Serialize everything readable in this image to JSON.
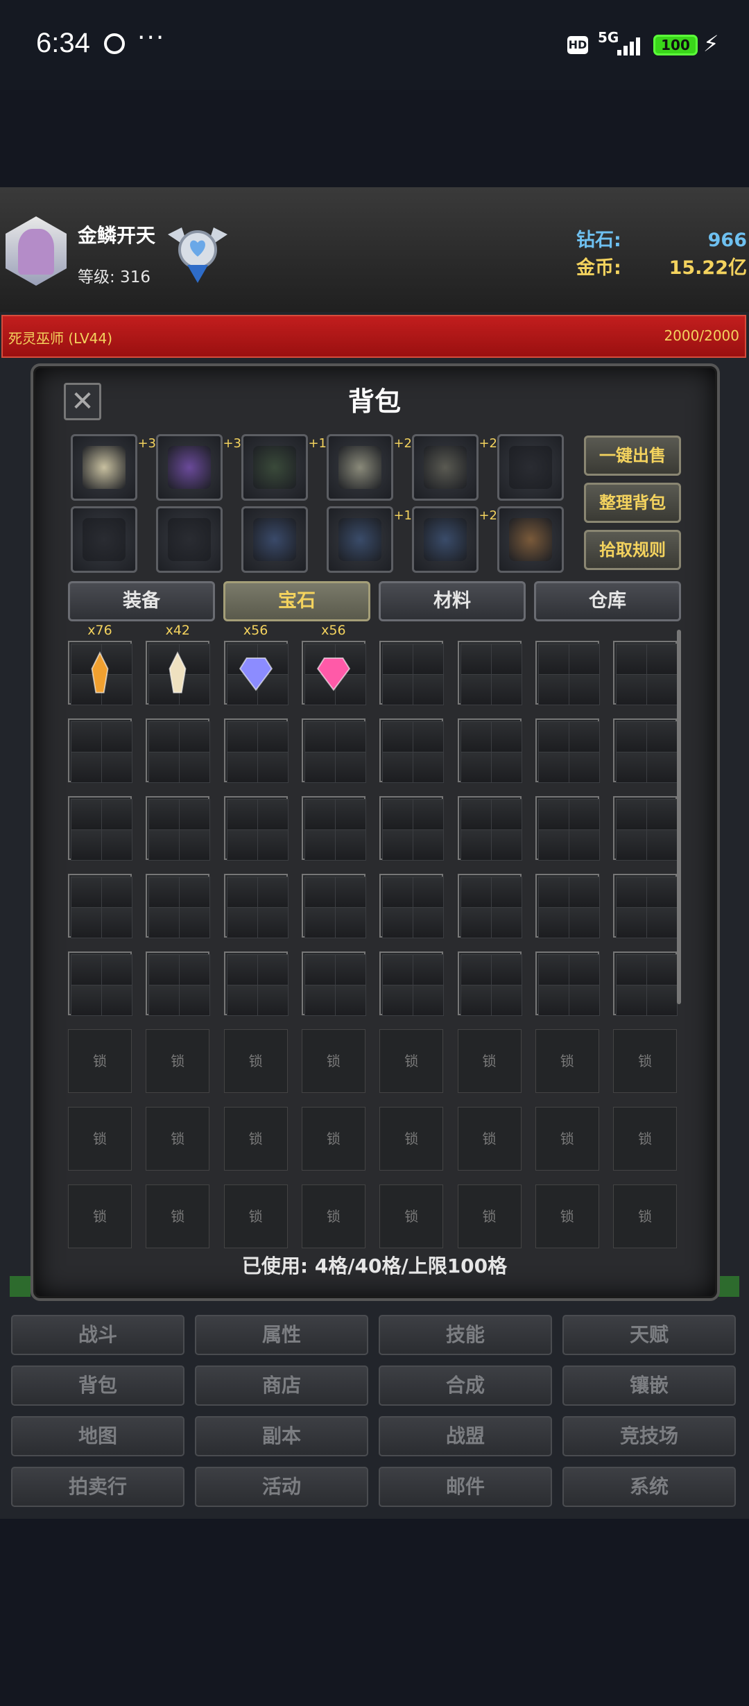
{
  "status_bar": {
    "time": "6:34",
    "dots": "···",
    "hd": "HD",
    "net": "5G",
    "battery": "100"
  },
  "player": {
    "name": "金鳞开天",
    "level_label": "等级: 316"
  },
  "currency": {
    "diamond_label": "钻石:",
    "diamond_value": "966",
    "gold_label": "金币:",
    "gold_value": "15.22亿"
  },
  "boss": {
    "name": "死灵巫师 (LV44)",
    "hp": "2000/2000",
    "hp_fraction": 1.0
  },
  "panel": {
    "title": "背包"
  },
  "equipment": [
    {
      "icon": "helmet-icon",
      "plus": "+3"
    },
    {
      "icon": "armor-icon",
      "plus": "+3"
    },
    {
      "icon": "cloak-icon",
      "plus": "+1"
    },
    {
      "icon": "gauntlet-icon",
      "plus": "+2"
    },
    {
      "icon": "chest-armor-icon",
      "plus": "+2"
    },
    {
      "icon": "wings-slot-icon",
      "plus": ""
    },
    {
      "icon": "empty-slot-icon",
      "plus": ""
    },
    {
      "icon": "empty-slot-icon",
      "plus": ""
    },
    {
      "icon": "necklace-icon",
      "plus": ""
    },
    {
      "icon": "ring-icon",
      "plus": "+1"
    },
    {
      "icon": "ring-icon",
      "plus": "+2"
    },
    {
      "icon": "dragon-pet-icon",
      "plus": ""
    }
  ],
  "actions": {
    "sell_all": "一键出售",
    "sort_bag": "整理背包",
    "pickup_rules": "拾取规则"
  },
  "tabs": [
    {
      "label": "装备",
      "active": false
    },
    {
      "label": "宝石",
      "active": true
    },
    {
      "label": "材料",
      "active": false
    },
    {
      "label": "仓库",
      "active": false
    }
  ],
  "items": [
    {
      "icon": "orange-crystal-icon",
      "count": "x76",
      "color": "#f0a030"
    },
    {
      "icon": "white-crystal-icon",
      "count": "x42",
      "color": "#efe1c0"
    },
    {
      "icon": "blue-diamond-icon",
      "count": "x56",
      "color": "#8c8cff"
    },
    {
      "icon": "pink-diamond-icon",
      "count": "x56",
      "color": "#ff5aa8"
    }
  ],
  "lock_label": "锁",
  "usage": "已使用: 4格/40格/上限100格",
  "menu": [
    "战斗",
    "属性",
    "技能",
    "天赋",
    "背包",
    "商店",
    "合成",
    "镶嵌",
    "地图",
    "副本",
    "战盟",
    "竞技场",
    "拍卖行",
    "活动",
    "邮件",
    "系统"
  ]
}
